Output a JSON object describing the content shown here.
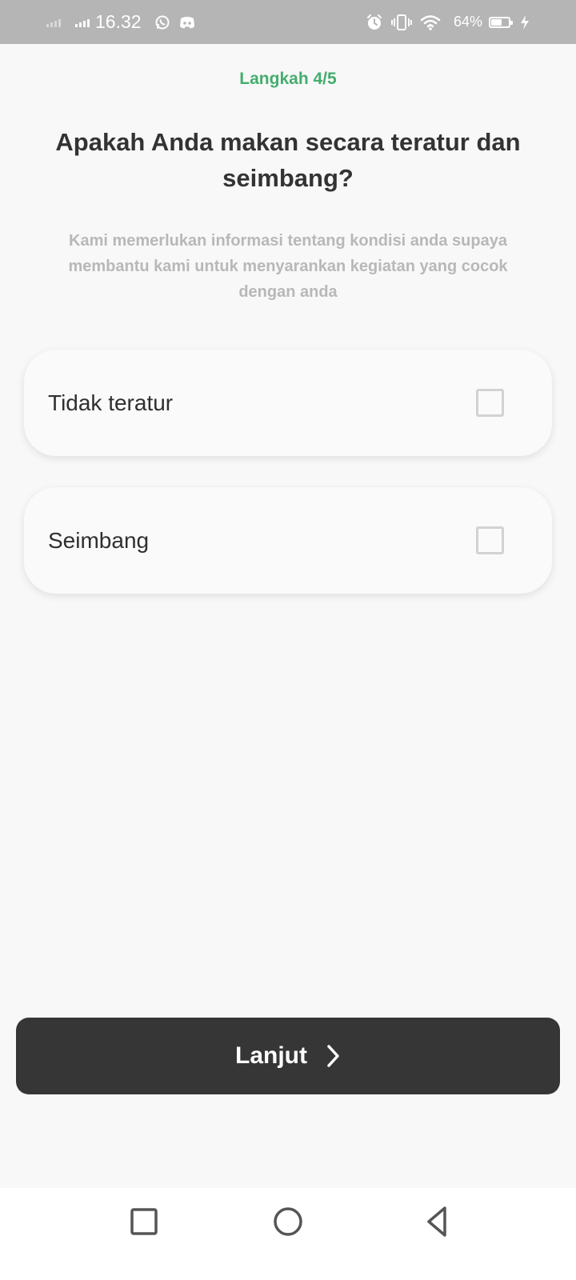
{
  "status_bar": {
    "time": "16.32",
    "battery_percent": "64%",
    "battery_level": 0.64,
    "icons": [
      "signal-icon",
      "whatsapp-icon",
      "discord-icon",
      "alarm-icon",
      "vibrate-icon",
      "wifi-icon",
      "battery-icon",
      "charging-icon"
    ]
  },
  "header": {
    "step": "Langkah 4/5",
    "question": "Apakah Anda makan secara teratur dan seimbang?",
    "description": "Kami memerlukan informasi tentang kondisi anda supaya membantu kami untuk menyarankan kegiatan yang cocok dengan anda"
  },
  "options": [
    {
      "label": "Tidak teratur",
      "checked": false
    },
    {
      "label": "Seimbang",
      "checked": false
    }
  ],
  "next_button": {
    "label": "Lanjut",
    "icon": "chevron-right-icon"
  },
  "nav_bar": {
    "buttons": [
      "recent-apps-icon",
      "home-icon",
      "back-icon"
    ]
  },
  "colors": {
    "accent": "#45ad6f",
    "button": "#363636",
    "background": "#f8f8f8",
    "status_bar": "#b5b5b5"
  }
}
